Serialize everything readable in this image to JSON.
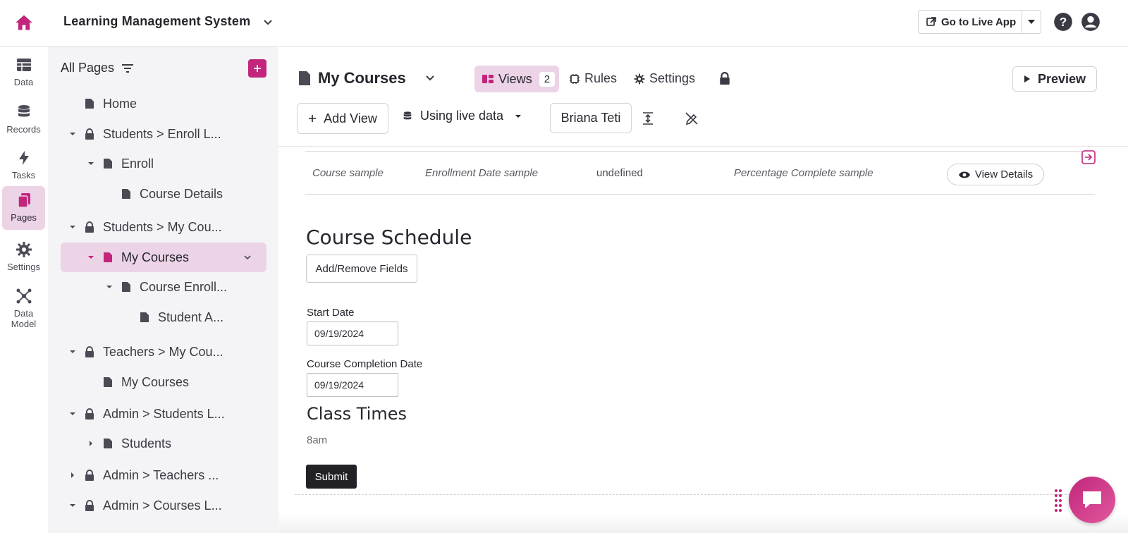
{
  "colors": {
    "accent": "#c2257b",
    "accent_light": "#ecd3e6",
    "dark_button": "#222226"
  },
  "topbar": {
    "app_title": "Learning Management System",
    "live_app_label": "Go to Live App"
  },
  "rail": {
    "items": [
      {
        "label": "Data",
        "icon": "table-icon"
      },
      {
        "label": "Records",
        "icon": "database-icon"
      },
      {
        "label": "Tasks",
        "icon": "bolt-icon"
      },
      {
        "label": "Pages",
        "icon": "pages-icon",
        "active": true
      },
      {
        "label": "Settings",
        "icon": "gear-icon"
      },
      {
        "label": "Data",
        "label2": "Model",
        "icon": "network-icon"
      }
    ]
  },
  "sidebar": {
    "header": "All Pages",
    "tree": [
      {
        "label": "Home",
        "type": "page"
      },
      {
        "label": "Students > Enroll L...",
        "type": "locked"
      },
      {
        "label": "Enroll",
        "type": "page"
      },
      {
        "label": "Course Details",
        "type": "page"
      },
      {
        "label": "Students > My Cou...",
        "type": "locked"
      },
      {
        "label": "My Courses",
        "type": "page",
        "selected": true
      },
      {
        "label": "Course Enroll...",
        "type": "page"
      },
      {
        "label": "Student A...",
        "type": "page"
      },
      {
        "label": "Teachers > My Cou...",
        "type": "locked"
      },
      {
        "label": "My Courses",
        "type": "page"
      },
      {
        "label": "Admin > Students L...",
        "type": "locked"
      },
      {
        "label": "Students",
        "type": "page"
      },
      {
        "label": "Admin > Teachers ...",
        "type": "locked"
      },
      {
        "label": "Admin > Courses L...",
        "type": "locked"
      }
    ]
  },
  "page_header": {
    "title": "My Courses",
    "views_label": "Views",
    "views_count": "2",
    "rules_label": "Rules",
    "settings_label": "Settings",
    "preview_label": "Preview",
    "add_view_label": "Add View",
    "data_source_label": "Using live data",
    "user_label": "Briana Teti"
  },
  "table": {
    "cells": [
      "Course sample",
      "Enrollment Date sample",
      "undefined",
      "Percentage Complete sample"
    ],
    "details_label": "View Details"
  },
  "form": {
    "title": "Course Schedule",
    "fields_button": "Add/Remove Fields",
    "start_label": "Start Date",
    "start_value": "09/19/2024",
    "completion_label": "Course Completion Date",
    "completion_value": "09/19/2024",
    "class_times_title": "Class Times",
    "class_times_value": "8am",
    "submit_label": "Submit"
  }
}
